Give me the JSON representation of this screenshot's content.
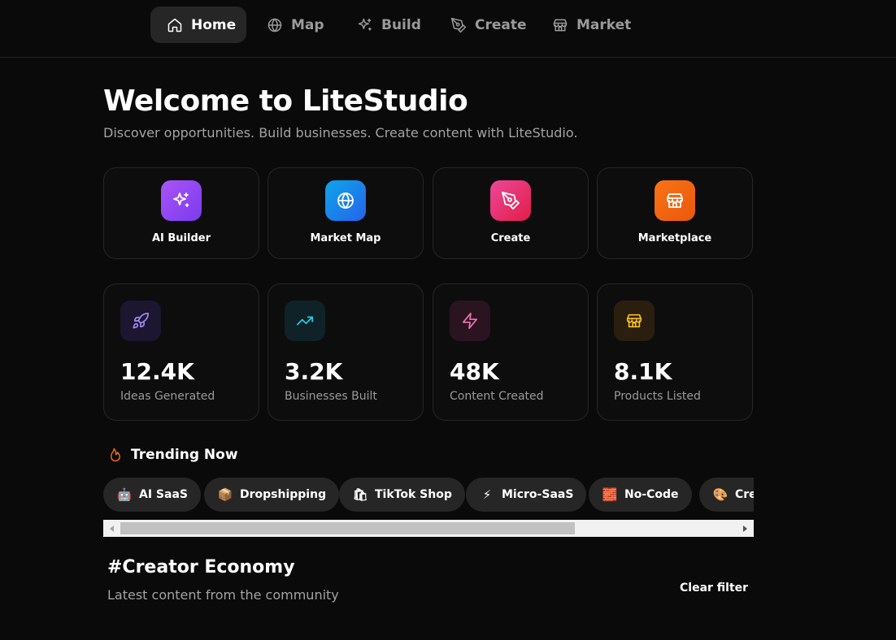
{
  "nav": {
    "items": [
      {
        "label": "Home",
        "icon": "home-icon",
        "active": true
      },
      {
        "label": "Map",
        "icon": "globe-icon"
      },
      {
        "label": "Build",
        "icon": "sparkles-icon"
      },
      {
        "label": "Create",
        "icon": "pen-tool-icon"
      },
      {
        "label": "Market",
        "icon": "store-icon"
      }
    ]
  },
  "hero": {
    "title": "Welcome to LiteStudio",
    "subtitle": "Discover opportunities. Build businesses. Create content with LiteStudio."
  },
  "quick_actions": [
    {
      "label": "AI Builder",
      "icon": "sparkles-icon",
      "color": "#9333ea"
    },
    {
      "label": "Market Map",
      "icon": "globe-icon",
      "color": "#0ea5e9"
    },
    {
      "label": "Create",
      "icon": "pen-tool-icon",
      "color": "#e11d48"
    },
    {
      "label": "Marketplace",
      "icon": "store-icon",
      "color": "#ea580c"
    }
  ],
  "stats": [
    {
      "value": "12.4K",
      "label": "Ideas Generated",
      "icon": "rocket-icon",
      "color": "#a78bfa",
      "bg": "#1c1630"
    },
    {
      "value": "3.2K",
      "label": "Businesses Built",
      "icon": "trending-up-icon",
      "color": "#22d3ee",
      "bg": "#0f2228"
    },
    {
      "value": "48K",
      "label": "Content Created",
      "icon": "zap-icon",
      "color": "#f472b6",
      "bg": "#2a1420"
    },
    {
      "value": "8.1K",
      "label": "Products Listed",
      "icon": "store-icon",
      "color": "#fbbf24",
      "bg": "#2a1f0e"
    }
  ],
  "trending": {
    "title": "Trending Now",
    "icon": "flame-icon",
    "chips": [
      {
        "label": "AI SaaS",
        "emoji": "🤖"
      },
      {
        "label": "Dropshipping",
        "emoji": "📦"
      },
      {
        "label": "TikTok Shop",
        "emoji": "🛍"
      },
      {
        "label": "Micro-SaaS",
        "emoji": "⚡"
      },
      {
        "label": "No-Code",
        "emoji": "🧱"
      },
      {
        "label": "Cre",
        "emoji": "🎨"
      }
    ]
  },
  "feed": {
    "title": "#Creator Economy",
    "subtitle": "Latest content from the community",
    "clear_label": "Clear filter"
  }
}
